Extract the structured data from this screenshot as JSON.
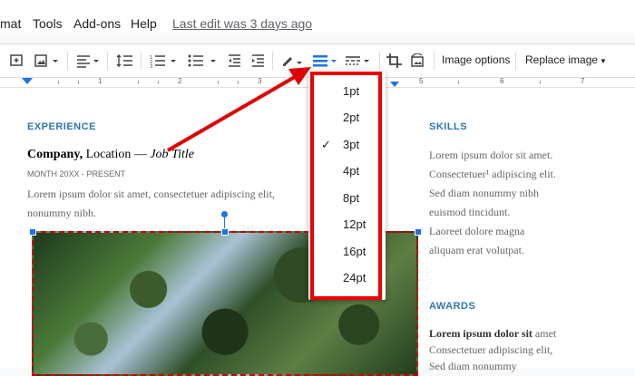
{
  "menubar": {
    "items": [
      "mat",
      "Tools",
      "Add-ons",
      "Help"
    ],
    "last_edit": "Last edit was 3 days ago"
  },
  "toolbar": {
    "image_options": "Image options",
    "replace_image": "Replace image"
  },
  "ruler": {
    "numbers": [
      "1",
      "2",
      "3",
      "4",
      "5",
      "6",
      "7"
    ]
  },
  "document": {
    "experience_heading": "EXPERIENCE",
    "company": "Company,",
    "location": " Location — ",
    "job_title": "Job Title",
    "month": "MONTH 20XX - PRESENT",
    "desc_line1": "Lorem ipsum dolor sit amet, consectetuer adipiscing elit,",
    "desc_line2": "nonummy nibh.",
    "skills_heading": "SKILLS",
    "skills_1": "Lorem ipsum dolor sit amet.",
    "skills_2": "Consectetuer¹ adipiscing elit.",
    "skills_3a": "Sed diam nonummy nibh",
    "skills_3b": "euismod tincidunt.",
    "skills_4a": "Laoreet dolore magna",
    "skills_4b": "aliquam erat volutpat.",
    "awards_heading": "AWARDS",
    "awards_bold": "Lorem ipsum dolor sit",
    "awards_1": " amet",
    "awards_2": "Consectetuer adipiscing elit,",
    "awards_3": "Sed diam nonummy"
  },
  "border_weight_menu": {
    "options": [
      "1pt",
      "2pt",
      "3pt",
      "4pt",
      "8pt",
      "12pt",
      "16pt",
      "24pt"
    ],
    "selected": "3pt",
    "check": "✓"
  },
  "colors": {
    "accent": "#1a73e8",
    "annotation": "#e00000",
    "heading": "#2e75b6"
  }
}
